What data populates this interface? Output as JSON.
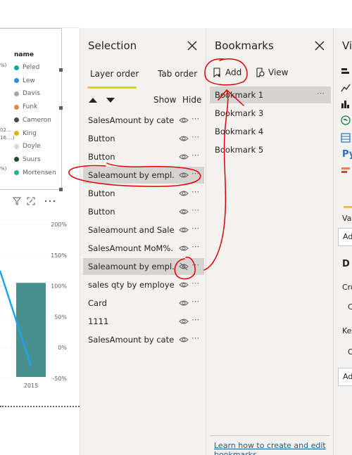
{
  "canvas": {
    "legend": {
      "title": "name",
      "items": [
        {
          "label": "Peled",
          "color": "#12a89d"
        },
        {
          "label": "Lew",
          "color": "#2e8bd8"
        },
        {
          "label": "Davis",
          "color": "#a6a6a6"
        },
        {
          "label": "Funk",
          "color": "#e8844b"
        },
        {
          "label": "Cameron",
          "color": "#4a4a4a"
        },
        {
          "label": "King",
          "color": "#e0b312"
        },
        {
          "label": "Doyle",
          "color": "#d9d9d9"
        },
        {
          "label": "Suurs",
          "color": "#1e4a2a"
        },
        {
          "label": "Mortensen",
          "color": "#24b48e"
        }
      ],
      "fragments": [
        "%)",
        "02...",
        "16....)",
        "%)"
      ]
    },
    "chart_data": {
      "type": "bar",
      "categories": [
        "2015"
      ],
      "values": [
        105
      ],
      "yticks": [
        "200%",
        "150%",
        "100%",
        "50%",
        "0%",
        "-50%"
      ],
      "ylim": [
        -50,
        200
      ],
      "bar_color": "#4a8f90",
      "line_color": "#1aa3ef"
    }
  },
  "selection": {
    "title": "Selection",
    "tabs": [
      "Layer order",
      "Tab order"
    ],
    "show_label": "Show",
    "hide_label": "Hide",
    "items": [
      {
        "label": "SalesAmount by cate..."
      },
      {
        "label": "Button"
      },
      {
        "label": "Button"
      },
      {
        "label": "Saleamount by empl..."
      },
      {
        "label": "Button"
      },
      {
        "label": "Button"
      },
      {
        "label": "Saleamount and Sale..."
      },
      {
        "label": "SalesAmount MoM%..."
      },
      {
        "label": "Saleamount by empl..."
      },
      {
        "label": "sales qty by employee"
      },
      {
        "label": "Card"
      },
      {
        "label": "1111"
      },
      {
        "label": "SalesAmount by cate..."
      }
    ],
    "selected_indexes": [
      3,
      8
    ],
    "hidden_index": 8
  },
  "bookmarks": {
    "title": "Bookmarks",
    "add_label": "Add",
    "view_label": "View",
    "items": [
      "Bookmark 1",
      "Bookmark 3",
      "Bookmark 4",
      "Bookmark 5"
    ],
    "selected_index": 0,
    "learn_link": "Learn how to create and edit",
    "learn_link_cont": "bookmarks"
  },
  "visualizations": {
    "title_fragment": "Vi",
    "fragments": [
      "Py",
      "Va",
      "Ad",
      "D",
      "Cro",
      "C",
      "Kee",
      "O",
      "Ad"
    ]
  },
  "icons": {
    "close": "close-icon",
    "more": "more-options-icon",
    "eye": "eye-icon",
    "eye_hidden": "eye-hidden-icon",
    "bookmark_add": "bookmark-add-icon",
    "view": "view-icon"
  },
  "colors": {
    "pane_bg": "#f3f2f1",
    "selected_row": "#d6d4d2",
    "accent_yellow": "#f2c811",
    "annotation_red": "#e00000",
    "link": "#1e5a8a"
  }
}
